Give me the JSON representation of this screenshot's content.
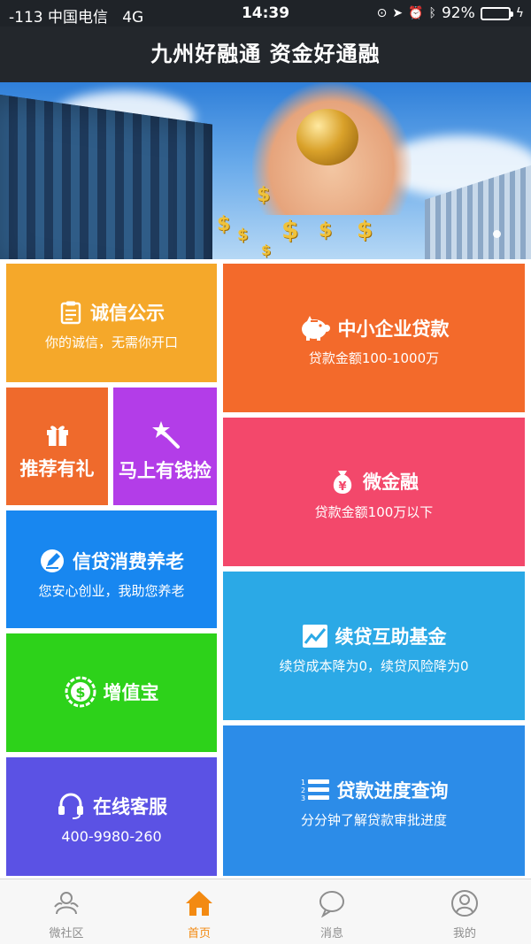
{
  "status_bar": {
    "carrier": "-113 中国电信",
    "network": "4G",
    "time": "14:39",
    "battery": "92%",
    "battery_level": 0.92
  },
  "header": {
    "title": "九州好融通 资金好通融"
  },
  "tiles": {
    "chengxin": {
      "title": "诚信公示",
      "sub": "你的诚信，无需你开口",
      "color": "#f5a82a",
      "icon": "clipboard-icon"
    },
    "tuijian": {
      "title": "推荐有礼",
      "color": "#ef6a2c",
      "icon": "gift-icon"
    },
    "mashang": {
      "title": "马上有钱捡",
      "color": "#b33de8",
      "icon": "magic-wand-icon"
    },
    "xindai": {
      "title": "信贷消费养老",
      "sub": "您安心创业，我助您养老",
      "color": "#1887f0",
      "icon": "pen-circle-icon"
    },
    "zengzhi": {
      "title": "增值宝",
      "color": "#2dd21a",
      "icon": "dollar-badge-icon"
    },
    "kefu": {
      "title": "在线客服",
      "sub": "400-9980-260",
      "color": "#5b52e4",
      "icon": "headset-icon"
    },
    "zhongxiao": {
      "title": "中小企业贷款",
      "sub": "贷款金额100-1000万",
      "color": "#f36a2b",
      "icon": "piggy-bank-icon"
    },
    "weijin": {
      "title": "微金融",
      "sub": "贷款金额100万以下",
      "color": "#f3486b",
      "icon": "money-bag-icon"
    },
    "xudai": {
      "title": "续贷互助基金",
      "sub": "续贷成本降为0，续贷风险降为0",
      "color": "#2ba9e6",
      "icon": "trend-chart-icon"
    },
    "jindu": {
      "title": "贷款进度查询",
      "sub": "分分钟了解贷款审批进度",
      "color": "#2c8ce8",
      "icon": "numbered-list-icon"
    }
  },
  "tabbar": {
    "items": [
      {
        "label": "微社区",
        "icon": "community-icon",
        "active": false
      },
      {
        "label": "首页",
        "icon": "home-icon",
        "active": true
      },
      {
        "label": "消息",
        "icon": "message-icon",
        "active": false
      },
      {
        "label": "我的",
        "icon": "profile-icon",
        "active": false
      }
    ],
    "active_color": "#f38a12"
  }
}
